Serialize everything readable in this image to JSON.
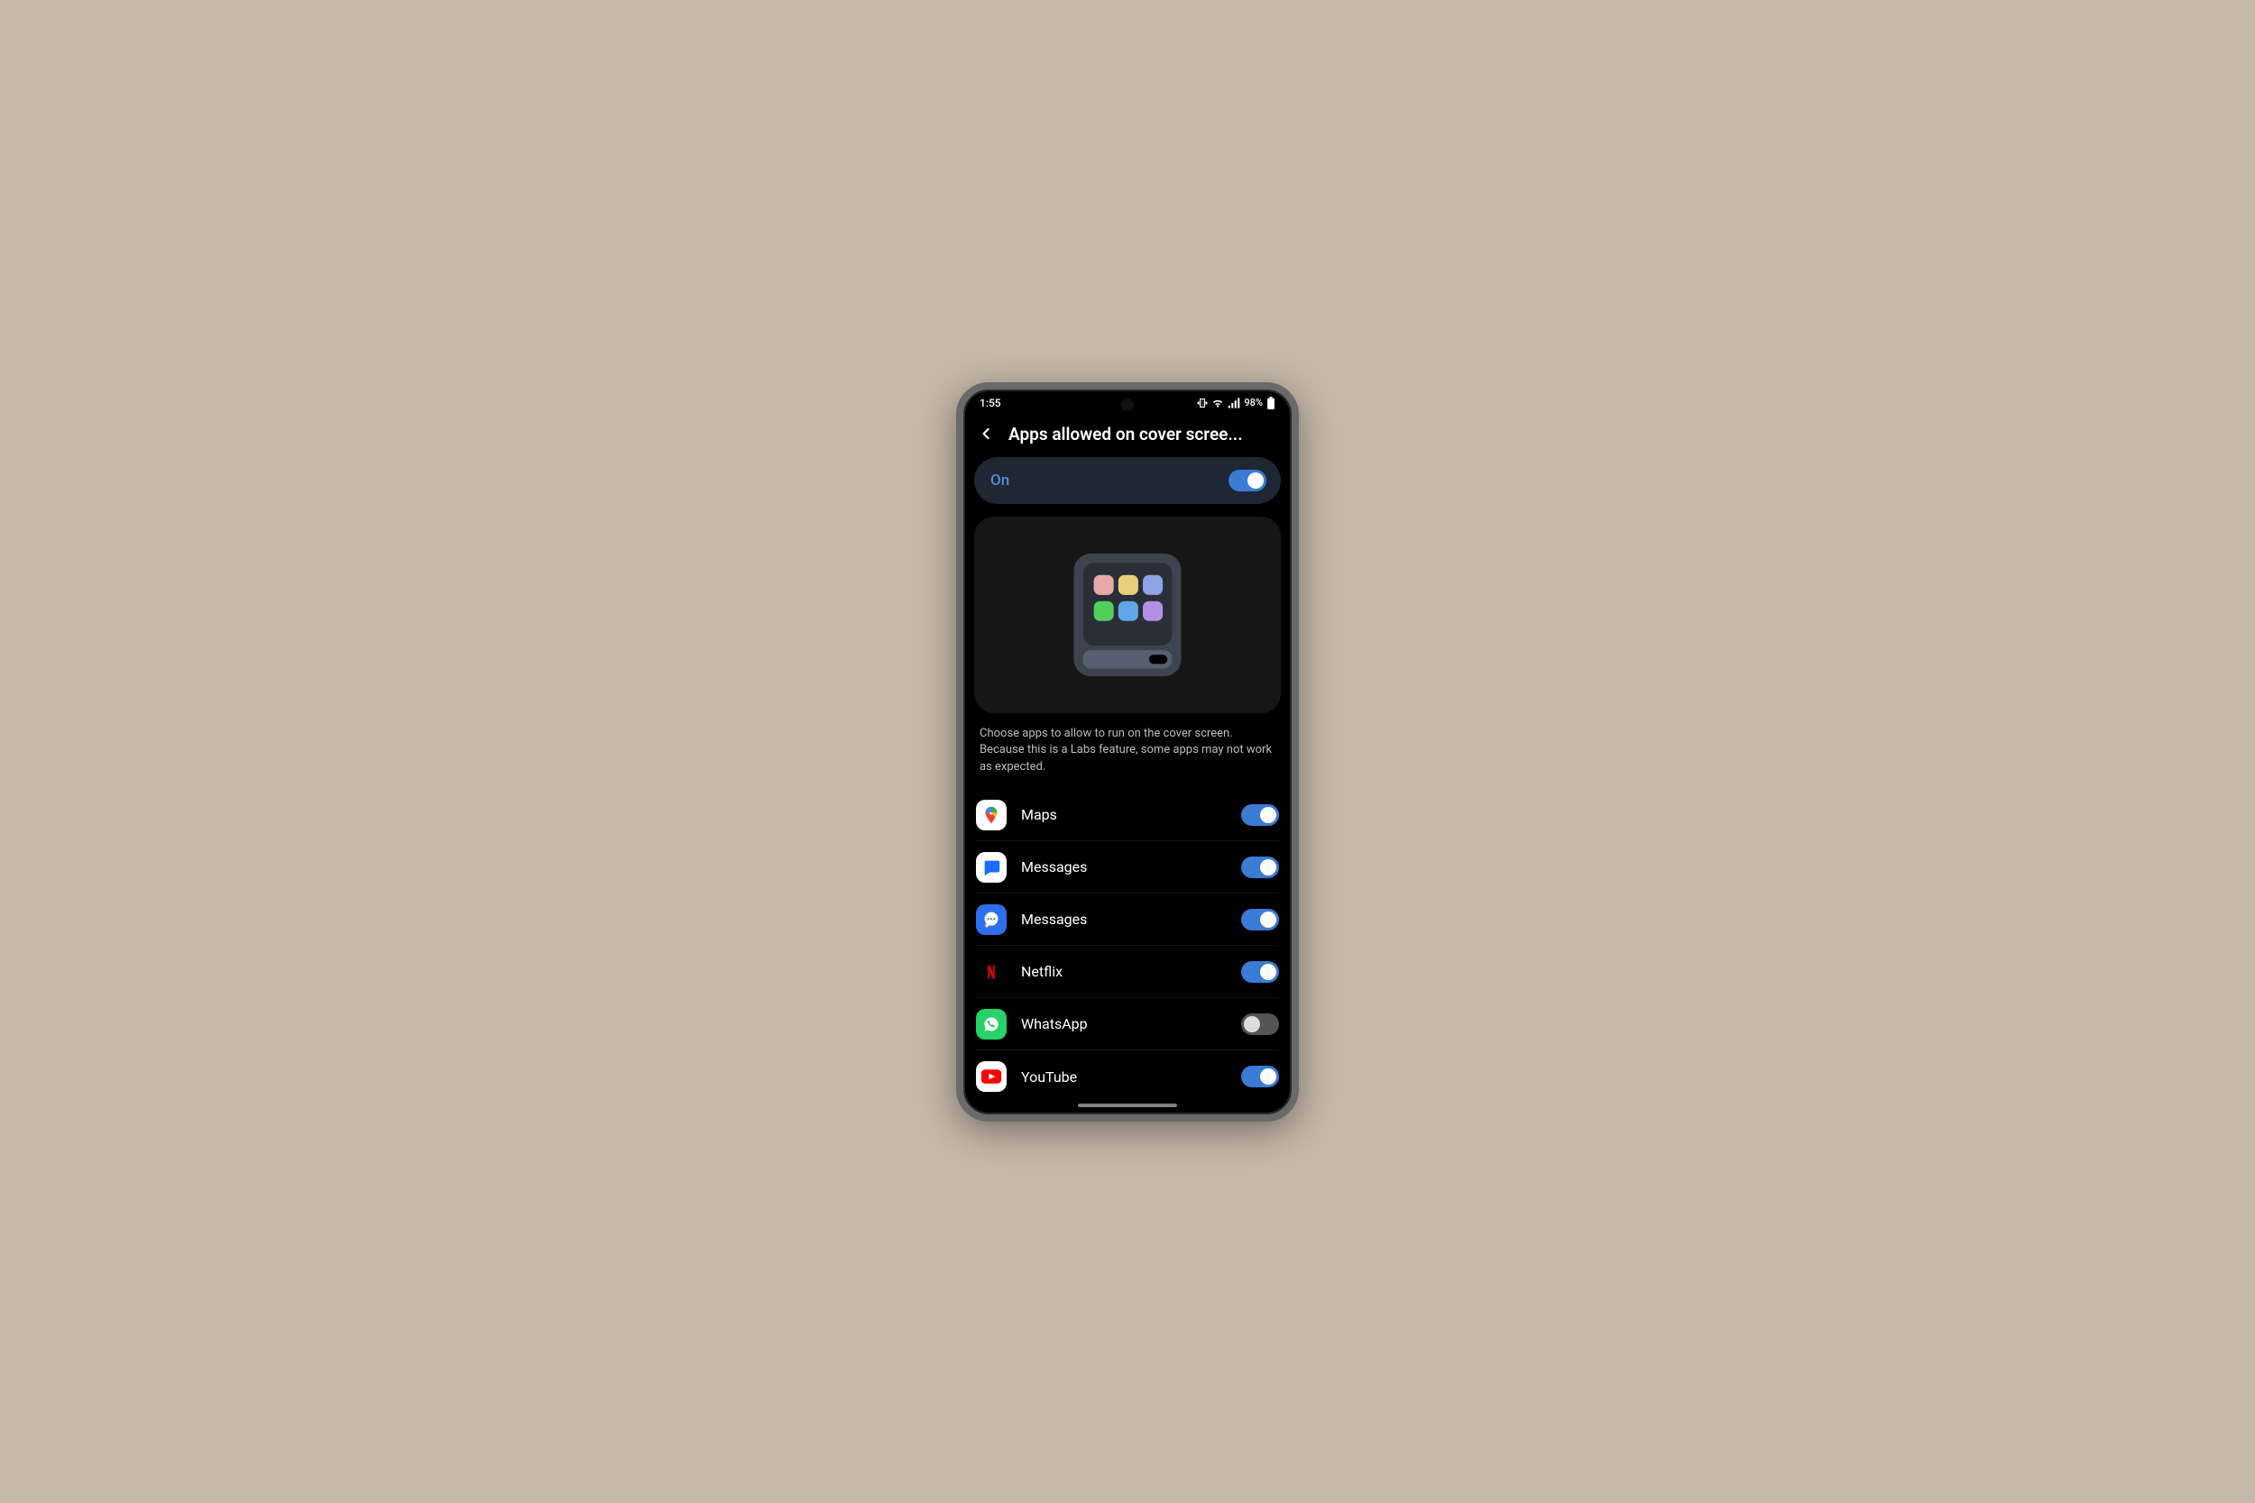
{
  "statusbar": {
    "time": "1:55",
    "battery": "98%"
  },
  "header": {
    "title": "Apps allowed on cover scree..."
  },
  "master": {
    "label": "On",
    "state": "on"
  },
  "description": "Choose apps to allow to run on the cover screen. Because this is a Labs feature, some apps may not work as expected.",
  "apps": [
    {
      "name": "Maps",
      "icon": "maps",
      "state": "on"
    },
    {
      "name": "Messages",
      "icon": "messages1",
      "state": "on"
    },
    {
      "name": "Messages",
      "icon": "messages2",
      "state": "on"
    },
    {
      "name": "Netflix",
      "icon": "netflix",
      "state": "on"
    },
    {
      "name": "WhatsApp",
      "icon": "whatsapp",
      "state": "off"
    },
    {
      "name": "YouTube",
      "icon": "youtube",
      "state": "on"
    }
  ]
}
